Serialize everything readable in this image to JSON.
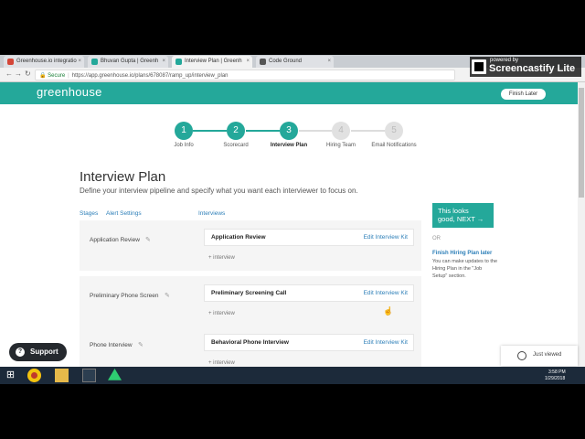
{
  "browser": {
    "tabs": [
      {
        "label": "Greenhouse.io integratio",
        "color": "#d44638"
      },
      {
        "label": "Bhuvan Gupta | Greenh",
        "color": "#24a89a"
      },
      {
        "label": "Interview Plan | Greenh",
        "color": "#24a89a"
      },
      {
        "label": "Code Ground",
        "color": "#555555"
      }
    ],
    "active_tab": 2,
    "secure_label": "Secure",
    "url": "https://app.greenhouse.io/plans/678087/ramp_up/interview_plan",
    "nav_back": "←",
    "nav_forward": "→",
    "nav_reload": "↻"
  },
  "recorder": {
    "powered": "powered by",
    "name": "Screencastify Lite"
  },
  "header": {
    "logo": "greenhouse",
    "finish_button": "Finish Later"
  },
  "steps": [
    {
      "num": "1",
      "label": "Job Info",
      "state": "done"
    },
    {
      "num": "2",
      "label": "Scorecard",
      "state": "done"
    },
    {
      "num": "3",
      "label": "Interview Plan",
      "state": "current"
    },
    {
      "num": "4",
      "label": "Hiring Team",
      "state": "todo"
    },
    {
      "num": "5",
      "label": "Email Notifications",
      "state": "todo"
    }
  ],
  "page": {
    "title": "Interview Plan",
    "subtitle": "Define your interview pipeline and specify what you want each interviewer to focus on.",
    "stages_link": "Stages",
    "alert_link": "Alert Settings",
    "interviews_link": "Interviews"
  },
  "stages": [
    {
      "name": "Application Review",
      "interview": "Application Review",
      "kit": "Edit Interview Kit",
      "add": "+ interview"
    },
    {
      "name": "Preliminary Phone Screen",
      "interview": "Preliminary Screening Call",
      "kit": "Edit Interview Kit",
      "add": "+ interview"
    },
    {
      "name": "Phone Interview",
      "interview": "Behavioral Phone Interview",
      "kit": "Edit Interview Kit",
      "add": "+ interview"
    }
  ],
  "sidebar": {
    "cta_line1": "This looks",
    "cta_line2": "good, NEXT →",
    "or": "OR",
    "finish_link": "Finish Hiring Plan later",
    "finish_note": "You can make updates to the Hiring Plan in the \"Job Setup\" section."
  },
  "support": {
    "label": "Support",
    "icon": "?"
  },
  "just_viewed": "Just viewed",
  "taskbar": {
    "time": "3:58 PM",
    "date": "1/29/2018"
  },
  "colors": {
    "brand": "#24a89a",
    "link": "#2d7fb8"
  }
}
